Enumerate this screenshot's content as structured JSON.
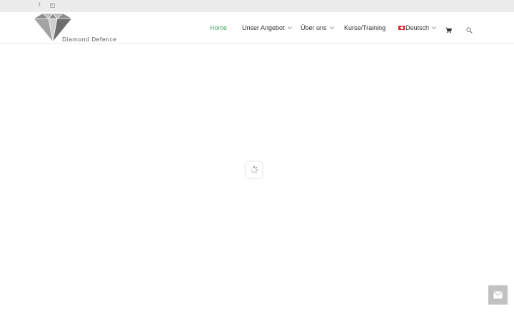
{
  "topbar": {
    "facebook": "f"
  },
  "brand": {
    "logo_text": "Diamond Defence"
  },
  "nav": {
    "items": [
      {
        "label": "Home",
        "active": true,
        "dropdown": false
      },
      {
        "label": "Unser Angebot",
        "dropdown": true
      },
      {
        "label": "Über uns",
        "dropdown": true
      },
      {
        "label": "Kurse/Training",
        "dropdown": false
      },
      {
        "label": "Deutsch",
        "dropdown": true,
        "flag": "swiss-flag-icon"
      }
    ],
    "active_color": "#3ea760",
    "cart": "cart-icon",
    "search": "search-icon"
  },
  "widgets": {
    "loader": "loading-spinner-icon",
    "contact": "envelope-icon"
  }
}
